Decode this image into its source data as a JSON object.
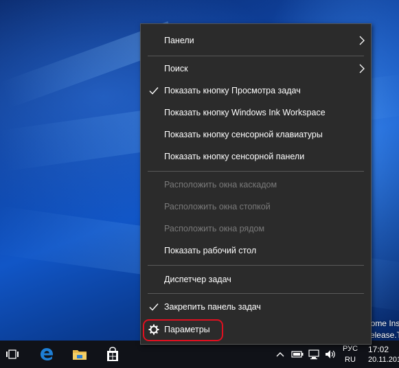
{
  "colors": {
    "highlight": "#e01020",
    "menu_bg": "#2b2b2b",
    "disabled_text": "#7a7a7a"
  },
  "desktop": {
    "partial_text_line1": "ome Insi",
    "partial_text_line2": "release.T"
  },
  "context_menu": {
    "items": [
      {
        "label": "Панели",
        "enabled": true,
        "checked": false,
        "submenu": true
      },
      {
        "label": "Поиск",
        "enabled": true,
        "checked": false,
        "submenu": true
      },
      {
        "label": "Показать кнопку Просмотра задач",
        "enabled": true,
        "checked": true,
        "submenu": false
      },
      {
        "label": "Показать кнопку Windows Ink Workspace",
        "enabled": true,
        "checked": false,
        "submenu": false
      },
      {
        "label": "Показать кнопку сенсорной клавиатуры",
        "enabled": true,
        "checked": false,
        "submenu": false
      },
      {
        "label": "Показать кнопку сенсорной панели",
        "enabled": true,
        "checked": false,
        "submenu": false
      },
      {
        "label": "Расположить окна каскадом",
        "enabled": false,
        "checked": false,
        "submenu": false
      },
      {
        "label": "Расположить окна стопкой",
        "enabled": false,
        "checked": false,
        "submenu": false
      },
      {
        "label": "Расположить окна рядом",
        "enabled": false,
        "checked": false,
        "submenu": false
      },
      {
        "label": "Показать рабочий стол",
        "enabled": true,
        "checked": false,
        "submenu": false
      },
      {
        "label": "Диспетчер задач",
        "enabled": true,
        "checked": false,
        "submenu": false
      },
      {
        "label": "Закрепить панель задач",
        "enabled": true,
        "checked": true,
        "submenu": false
      },
      {
        "label": "Параметры",
        "enabled": true,
        "checked": false,
        "submenu": false,
        "icon": "gear-icon",
        "highlighted": true
      }
    ]
  },
  "taskbar": {
    "buttons": [
      "task-view-icon",
      "edge-icon",
      "file-explorer-icon",
      "store-icon"
    ],
    "tray": {
      "icons": [
        "chevron-up-icon",
        "battery-icon",
        "network-icon",
        "volume-icon"
      ],
      "language_line1": "РУС",
      "language_line2": "RU",
      "time": "17:02",
      "date": "20.11.201"
    }
  }
}
